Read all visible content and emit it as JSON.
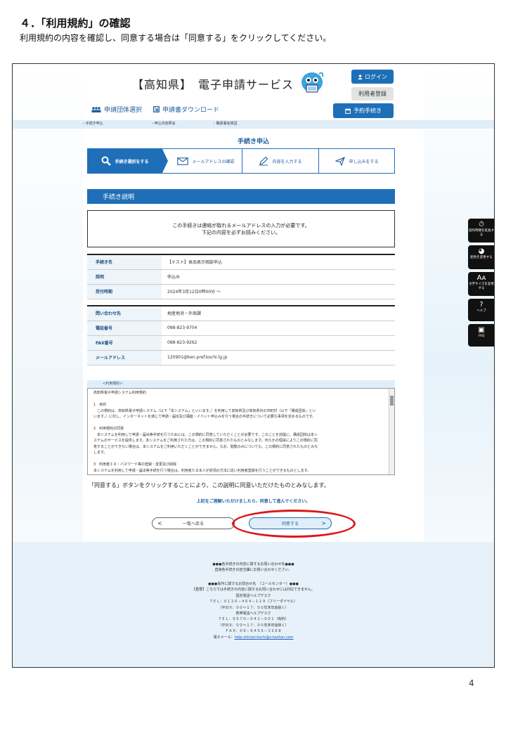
{
  "doc": {
    "heading": "４．「利用規約」の確認",
    "subheading": "利用規約の内容を確認し、同意する場合は「同意する」をクリックしてください。",
    "page_number": "4"
  },
  "header": {
    "title": "【高知県】　電子申請サービス",
    "login_label": "ログイン",
    "register_label": "利用者登録",
    "nav": [
      {
        "label": "申請団体選択",
        "icon": "group-icon"
      },
      {
        "label": "申請書ダウンロード",
        "icon": "download-icon"
      }
    ],
    "reserve_label": "予約手続き"
  },
  "breadcrumbs": [
    "› 手続き申込",
    "› 申込内容照会",
    "› 職責署名検証"
  ],
  "page_title": "手続き申込",
  "steps": [
    {
      "label": "手続き選択をする",
      "icon": "search-icon",
      "active": true
    },
    {
      "label": "メールアドレスの確認",
      "icon": "mail-icon",
      "active": false
    },
    {
      "label": "内容を入力する",
      "icon": "pen-icon",
      "active": false
    },
    {
      "label": "申し込みをする",
      "icon": "send-icon",
      "active": false
    }
  ],
  "section_title": "手続き説明",
  "notice": {
    "line1": "この手続きは連絡が取れるメールアドレスの入力が必要です。",
    "line2": "下記の内容を必ずお読みください。"
  },
  "procedure_table": [
    {
      "label": "手続き名",
      "value": "【テスト】食品表示相談申込"
    },
    {
      "label": "説明",
      "value": "申込み"
    },
    {
      "label": "受付時期",
      "value": "2024年3月12日0時00分 ～"
    }
  ],
  "contact_table": [
    {
      "label": "問い合わせ先",
      "value": "地産地消・外商課"
    },
    {
      "label": "電話番号",
      "value": "088-823-9704"
    },
    {
      "label": "FAX番号",
      "value": "088-823-9262"
    },
    {
      "label": "メールアドレス",
      "value": "120901@ken.pref.kochi.lg.jp"
    }
  ],
  "terms": {
    "label": "<利用規約>",
    "title": "高知県電子申請システム利用規約",
    "body": [
      "",
      "1　目的",
      "　この規約は、高知県電子申請システム（以下「本システム」といいます。）を利用して高知県及び高知県内の市町村（以下「構成団体」とい",
      "います。）に対し、インターネットを通じて申請・届出及び講座・イベント申込みを行う場合の手続きについて必要な事項を定めるものです。",
      "",
      "2　利用規約の同意",
      "　本システムを利用して申請・届出等手続を行うためには、この規約に同意していただくことが必要です。このことを前提に、構成団体は本シ",
      "ステムのサービスを提供します。本システムをご利用された方は、この規約に同意されたものとみなします。何らかの理由によりこの規約に同",
      "意することができない場合は、本システムをご利用いただくことができません。なお、閲覧のみについても、この規約に同意されたものとみな",
      "します。",
      "",
      "3　利用者ＩＤ・パスワード等の登録・変更及び削除",
      "本システムを利用して申請・届出等手続を行う場合は、利用者たる本人が前項の方法に従い利用者登録を行うことができるものとします。"
    ]
  },
  "agree_note": "「同意する」ボタンをクリックすることにより、この説明に同意いただけたものとみなします。",
  "proceed_note": "上記をご理解いただけましたら、同意して進んでください。",
  "buttons": {
    "back_label": "一覧へ戻る",
    "back_arrow": "<",
    "agree_label": "同意する",
    "agree_arrow": ">"
  },
  "footer": {
    "lines_a": [
      "●●●各手続きの内容に関するお問い合わせ先●●●",
      "直接各手続きの担当課にお問い合わせください。"
    ],
    "lines_b": [
      "●●●操作に関するお問合せ先　（コールセンター）●●●",
      "【重要】こちらでは手続きの内容に関するお問い合わせには対応できません。",
      "固定電話ヘルプデスク",
      "ＴＥＬ：０１２０－４６４－１１９（フリーダイヤル）",
      "（平日９：００～１７：００年末年始除く）",
      "携帯電話ヘルプデスク",
      "ＴＥＬ：０５７０－０４１－００１（有料）",
      "（平日９：００～１７：００年末年始除く）",
      "ＦＡＸ：０６－６４５５－３２６８"
    ],
    "email_prefix": "電子メール：",
    "email": "help-shinsei-kochi@s-kantan.com"
  },
  "side_tools": [
    {
      "label": "操作時間を延長する",
      "icon": "timer-icon"
    },
    {
      "label": "配色を変更する",
      "icon": "palette-icon"
    },
    {
      "label": "文字サイズを変更する",
      "icon": "font-size-icon"
    },
    {
      "label": "ヘルプ",
      "icon": "help-icon"
    },
    {
      "label": "FAQ",
      "icon": "faq-icon"
    }
  ],
  "colors": {
    "brand": "#1f6fb8",
    "highlight": "#d9191c",
    "light": "#dfeef8"
  }
}
